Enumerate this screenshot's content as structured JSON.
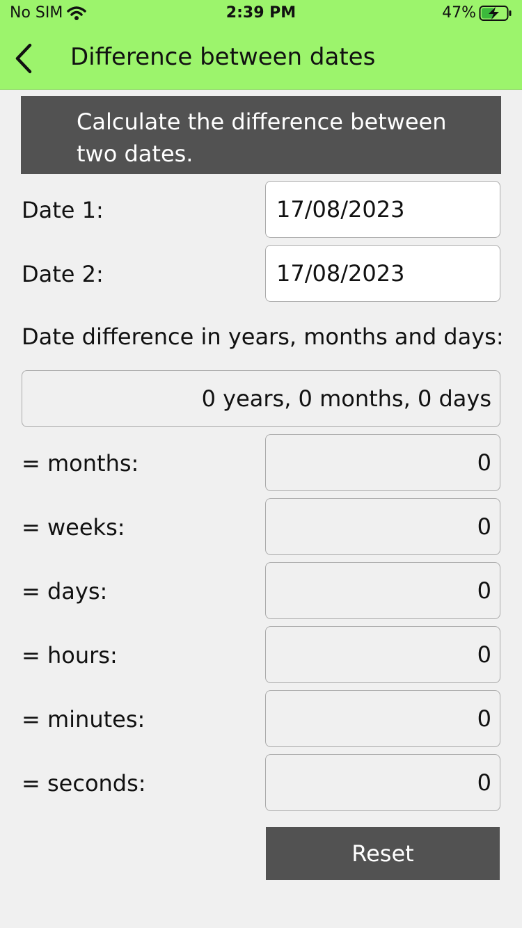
{
  "status_bar": {
    "carrier": "No SIM",
    "time": "2:39 PM",
    "battery": "47%"
  },
  "nav": {
    "title": "Difference between dates"
  },
  "banner": {
    "text": "Calculate the difference between two dates."
  },
  "inputs": {
    "date1_label": "Date 1:",
    "date1_value": "17/08/2023",
    "date2_label": "Date 2:",
    "date2_value": "17/08/2023"
  },
  "summary": {
    "label": "Date difference in years, months and days:",
    "value": "0 years, 0 months, 0 days"
  },
  "results": [
    {
      "label": "= months:",
      "value": "0"
    },
    {
      "label": "= weeks:",
      "value": "0"
    },
    {
      "label": "= days:",
      "value": "0"
    },
    {
      "label": "= hours:",
      "value": "0"
    },
    {
      "label": "= minutes:",
      "value": "0"
    },
    {
      "label": "= seconds:",
      "value": "0"
    }
  ],
  "buttons": {
    "reset_label": "Reset"
  },
  "colors": {
    "header_bg": "#9cf46c",
    "banner_bg": "#525252",
    "button_bg": "#525252",
    "page_bg": "#f0f0f0"
  }
}
